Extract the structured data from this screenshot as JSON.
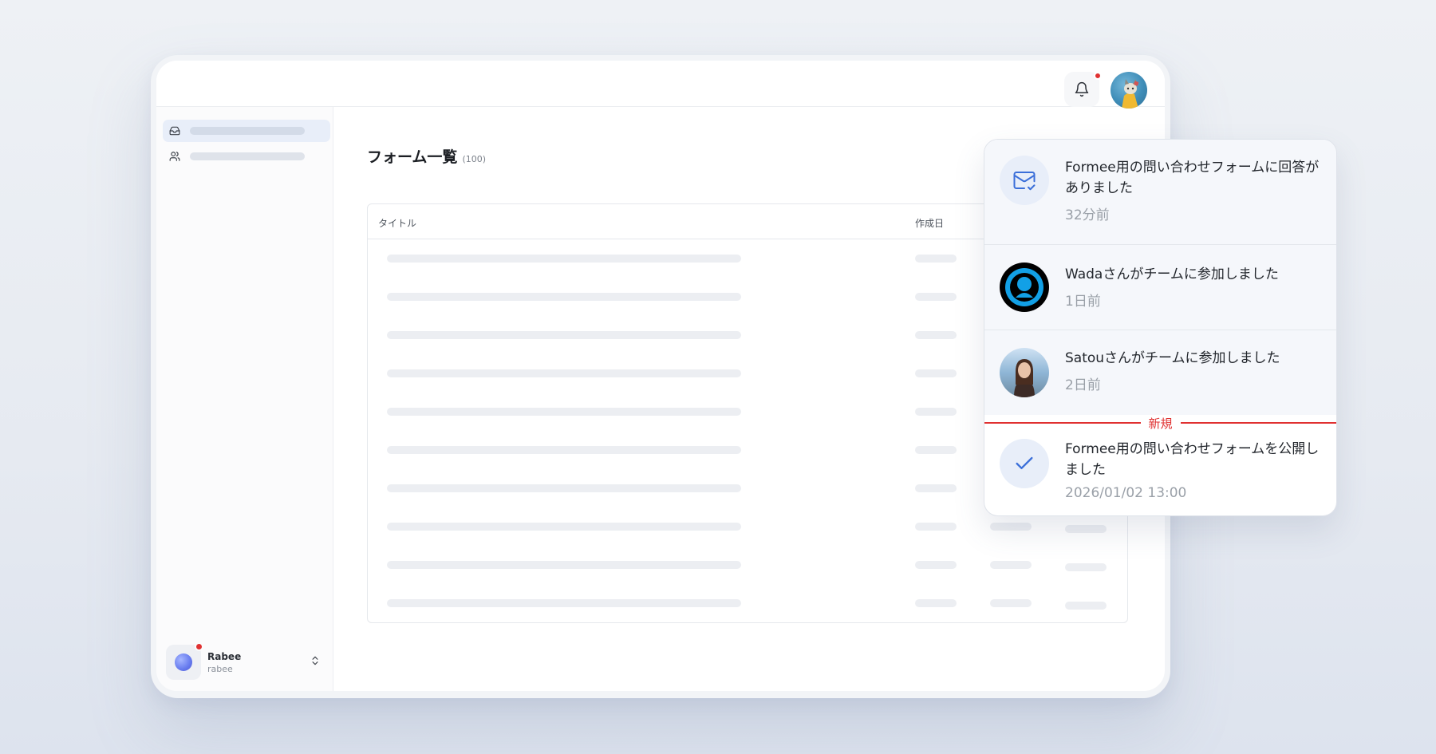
{
  "page": {
    "title": "フォーム一覧",
    "count": "(100)"
  },
  "table": {
    "columns": [
      "タイトル",
      "作成日"
    ],
    "skeleton_rows": 10
  },
  "user": {
    "name": "Rabee",
    "handle": "rabee"
  },
  "notifications": {
    "items": [
      {
        "message": "Formee用の問い合わせフォームに回答がありました",
        "time": "32分前",
        "icon": "mail-check-icon",
        "unread": true
      },
      {
        "message": "Wadaさんがチームに参加しました",
        "time": "1日前",
        "icon": "user-avatar",
        "unread": true
      },
      {
        "message": "Satouさんがチームに参加しました",
        "time": "2日前",
        "icon": "user-photo",
        "unread": true
      },
      {
        "message": "Formee用の問い合わせフォームを公開しました",
        "time": "2026/01/02 13:00",
        "icon": "check-icon",
        "unread": false
      }
    ],
    "divider_label": "新規"
  },
  "colors": {
    "accent": "#3b6fd9",
    "badge": "#e03131",
    "unread_bg": "#f5f7fb"
  }
}
